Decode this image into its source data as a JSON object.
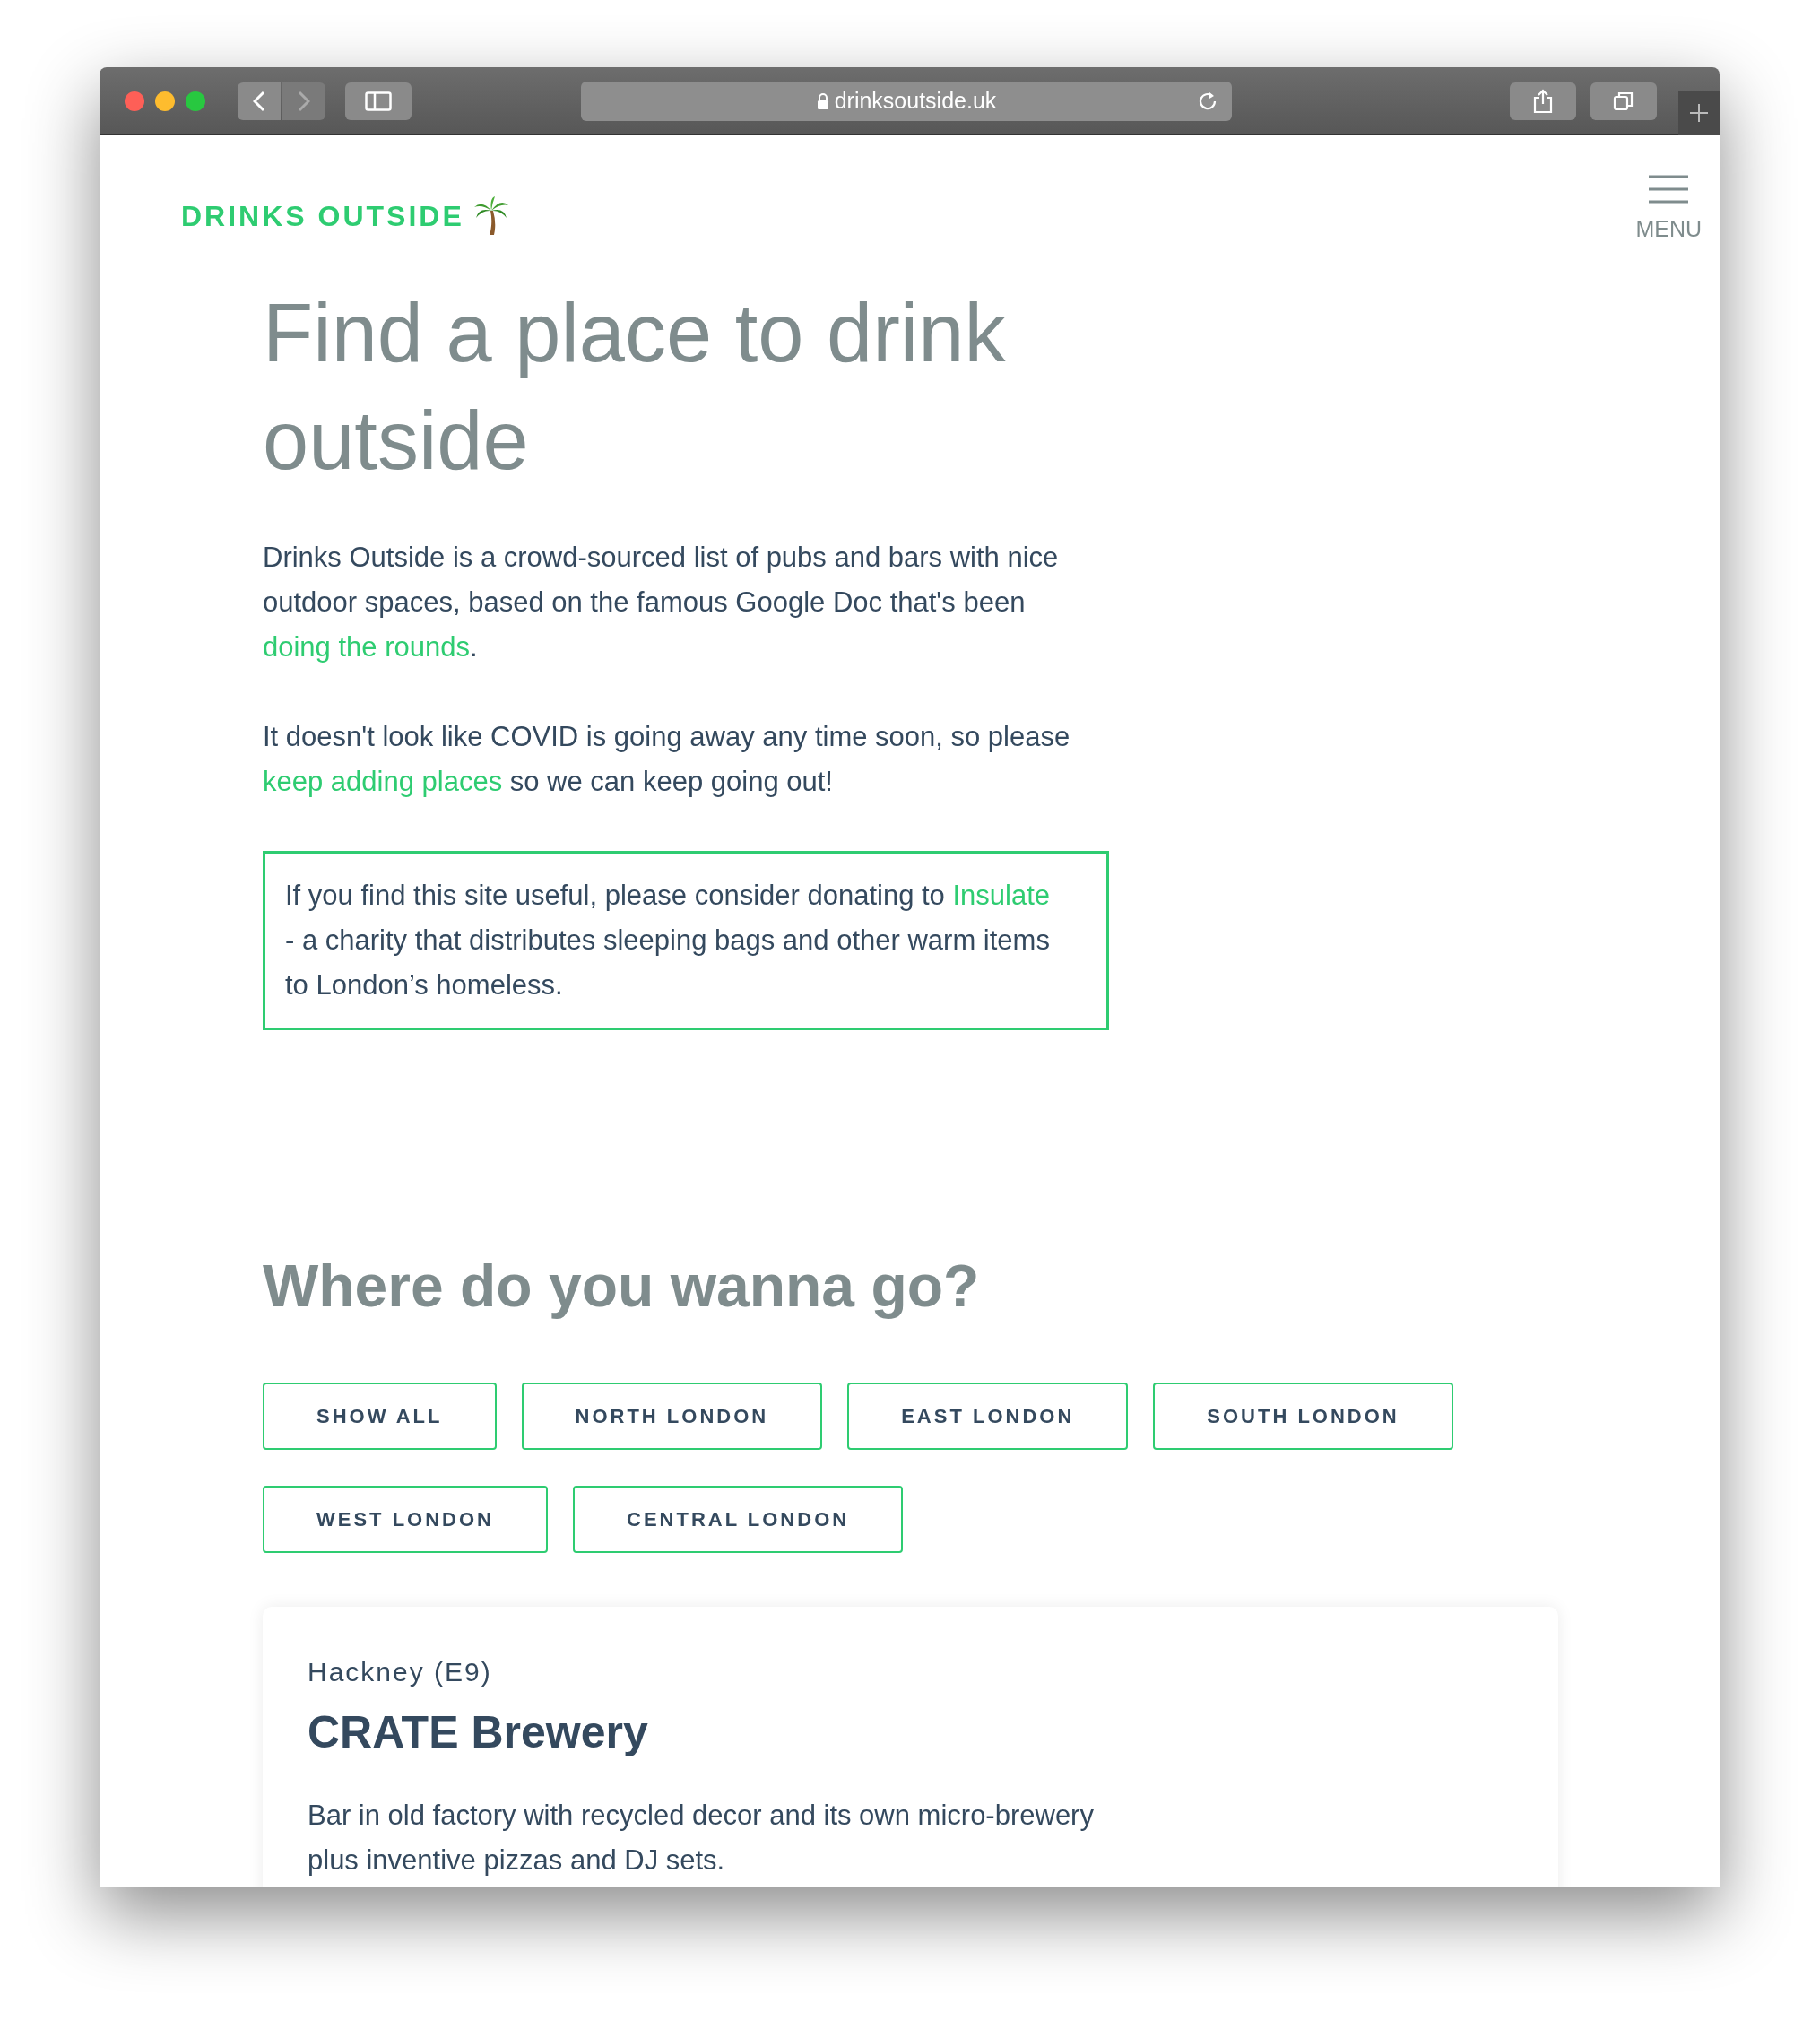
{
  "browser": {
    "url": "drinksoutside.uk"
  },
  "header": {
    "logo": "DRINKS OUTSIDE",
    "menu_label": "MENU"
  },
  "hero": {
    "title": "Find a place to drink outside",
    "paragraphs": [
      [
        {
          "text": "Drinks Outside is a crowd-sourced list of pubs and bars with nice outdoor spaces, based on the famous Google Doc that's been ",
          "link": false
        },
        {
          "text": "doing the rounds",
          "link": true
        },
        {
          "text": ".",
          "link": false
        }
      ],
      [
        {
          "text": "It doesn't look like COVID is going away any time soon, so please ",
          "link": false
        },
        {
          "text": "keep adding places",
          "link": true
        },
        {
          "text": " so we can keep going out!",
          "link": false
        }
      ]
    ],
    "notice": [
      {
        "text": "If you find this site useful, please consider donating to ",
        "link": false
      },
      {
        "text": "Insulate",
        "link": true
      },
      {
        "text": " - a charity that distributes sleeping bags and other warm items to London’s homeless.",
        "link": false
      }
    ]
  },
  "filters": {
    "title": "Where do you wanna go?",
    "buttons": [
      "SHOW ALL",
      "NORTH LONDON",
      "EAST LONDON",
      "SOUTH LONDON",
      "WEST LONDON",
      "CENTRAL LONDON"
    ]
  },
  "venues": [
    {
      "area": "Hackney (E9)",
      "name": "CRATE Brewery",
      "description": "Bar in old factory with recycled decor and its own micro-brewery plus inventive pizzas and DJ sets."
    }
  ]
}
